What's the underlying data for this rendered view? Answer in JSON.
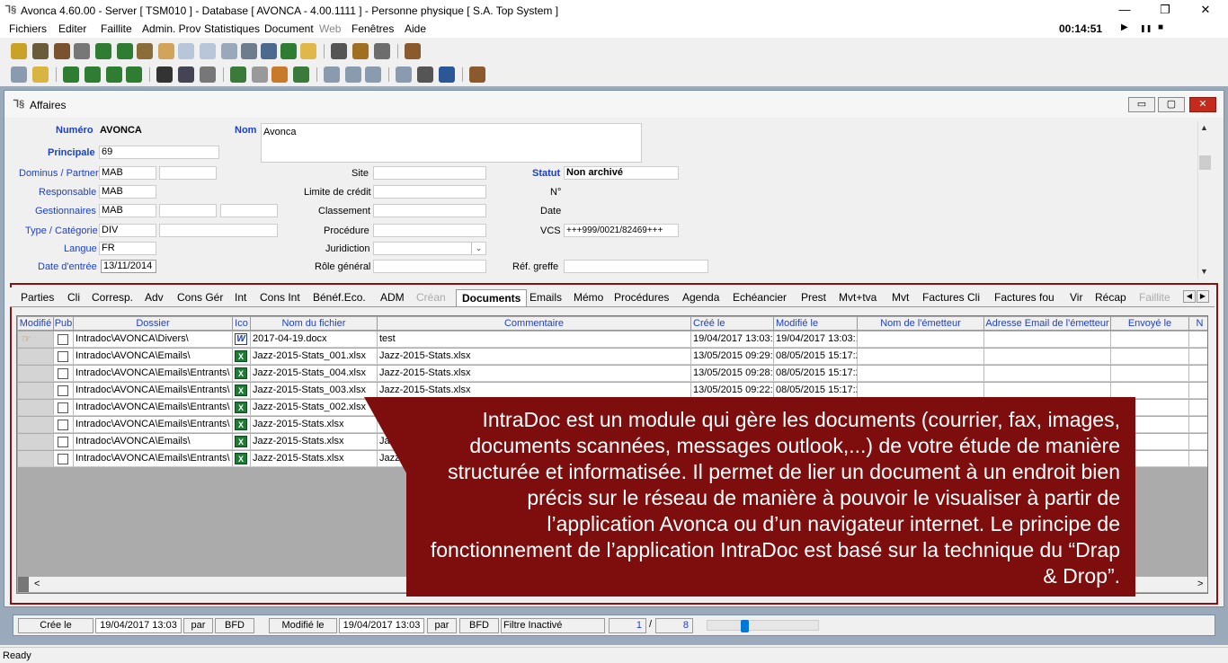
{
  "window": {
    "title": "Avonca 4.60.00 - Server [ TSM010 ] - Database [ AVONCA - 4.00.1111 ] - Personne physique [ S.A. Top System ]",
    "minimize": "—",
    "restore": "❐",
    "close": "✕"
  },
  "menu": {
    "items": [
      "Fichiers",
      "Editer",
      "Faillite",
      "Admin. Prov",
      "Statistiques",
      "Document",
      "Web",
      "Fenêtres",
      "Aide"
    ],
    "timer": "00:14:51",
    "play": "▶",
    "pause": "❚❚",
    "stop": "■"
  },
  "child": {
    "title": "Affaires",
    "min": "▭",
    "max": "▢",
    "close": "✕"
  },
  "form": {
    "numero_label": "Numéro",
    "numero_value": "AVONCA",
    "nom_label": "Nom",
    "nom_value": "Avonca",
    "principale_label": "Principale",
    "principale_value": "69",
    "dominus_label": "Dominus / Partner",
    "dominus_value": "MAB",
    "responsable_label": "Responsable",
    "responsable_value": "MAB",
    "gestionnaires_label": "Gestionnaires",
    "gestionnaires_value": "MAB",
    "type_label": "Type / Catégorie",
    "type_value": "DIV",
    "langue_label": "Langue",
    "langue_value": "FR",
    "date_entree_label": "Date d'entrée",
    "date_entree_value": "13/11/2014",
    "site_label": "Site",
    "limite_label": "Limite de crédit",
    "classement_label": "Classement",
    "procedure_label": "Procédure",
    "juridiction_label": "Juridiction",
    "role_label": "Rôle général",
    "statut_label": "Statut",
    "statut_value": "Non archivé",
    "no_label": "N°",
    "date_label": "Date",
    "vcs_label": "VCS",
    "vcs_value": "+++999/0021/82469+++",
    "ref_greffe_label": "Réf. greffe"
  },
  "tabs": [
    {
      "label": "Parties"
    },
    {
      "label": "Cli"
    },
    {
      "label": "Corresp."
    },
    {
      "label": "Adv"
    },
    {
      "label": "Cons Gér"
    },
    {
      "label": "Int"
    },
    {
      "label": "Cons Int"
    },
    {
      "label": "Bénéf.Eco."
    },
    {
      "label": "ADM"
    },
    {
      "label": "Créan"
    },
    {
      "label": "Documents"
    },
    {
      "label": "Emails"
    },
    {
      "label": "Mémo"
    },
    {
      "label": "Procédures"
    },
    {
      "label": "Agenda"
    },
    {
      "label": "Echéancier"
    },
    {
      "label": "Prest"
    },
    {
      "label": "Mvt+tva"
    },
    {
      "label": "Mvt"
    },
    {
      "label": "Factures Cli"
    },
    {
      "label": "Factures fou"
    },
    {
      "label": "Vir"
    },
    {
      "label": "Récap"
    },
    {
      "label": "Faillite"
    }
  ],
  "grid": {
    "headers": [
      "Modifié",
      "Pub",
      "Dossier",
      "Ico",
      "Nom du fichier",
      "Commentaire",
      "Créé le",
      "Modifié le",
      "Nom de l'émetteur",
      "Adresse Email de l'émetteur",
      "Envoyé le",
      "N"
    ],
    "rows": [
      {
        "dossier": "Intradoc\\AVONCA\\Divers\\",
        "ico": "W",
        "fichier": "2017-04-19.docx",
        "commentaire": "test",
        "cree": "19/04/2017 13:03:1",
        "modifie": "19/04/2017 13:03:1"
      },
      {
        "dossier": "Intradoc\\AVONCA\\Emails\\",
        "ico": "X",
        "fichier": "Jazz-2015-Stats_001.xlsx",
        "commentaire": "Jazz-2015-Stats.xlsx",
        "cree": "13/05/2015 09:29:",
        "modifie": "08/05/2015 15:17:2"
      },
      {
        "dossier": "Intradoc\\AVONCA\\Emails\\Entrants\\",
        "ico": "X",
        "fichier": "Jazz-2015-Stats_004.xlsx",
        "commentaire": "Jazz-2015-Stats.xlsx",
        "cree": "13/05/2015 09:28:3",
        "modifie": "08/05/2015 15:17:2"
      },
      {
        "dossier": "Intradoc\\AVONCA\\Emails\\Entrants\\",
        "ico": "X",
        "fichier": "Jazz-2015-Stats_003.xlsx",
        "commentaire": "Jazz-2015-Stats.xlsx",
        "cree": "13/05/2015 09:22:5",
        "modifie": "08/05/2015 15:17:2"
      },
      {
        "dossier": "Intradoc\\AVONCA\\Emails\\Entrants\\",
        "ico": "X",
        "fichier": "Jazz-2015-Stats_002.xlsx",
        "commentaire": "",
        "cree": "",
        "modifie": ""
      },
      {
        "dossier": "Intradoc\\AVONCA\\Emails\\Entrants\\",
        "ico": "X",
        "fichier": "Jazz-2015-Stats.xlsx",
        "commentaire": "",
        "cree": "",
        "modifie": ""
      },
      {
        "dossier": "Intradoc\\AVONCA\\Emails\\",
        "ico": "X",
        "fichier": "Jazz-2015-Stats.xlsx",
        "commentaire": "Ja",
        "cree": "",
        "modifie": ""
      },
      {
        "dossier": "Intradoc\\AVONCA\\Emails\\Entrants\\",
        "ico": "X",
        "fichier": "Jazz-2015-Stats.xlsx",
        "commentaire": "Jazz",
        "cree": "",
        "modifie": ""
      }
    ]
  },
  "overlay": {
    "text": "IntraDoc est un module qui gère les documents (courrier, fax, images, documents scannées, messages outlook,...) de votre étude de manière structurée et informatisée. Il permet de lier un document à un endroit bien précis sur le réseau de manière à pouvoir le visualiser à partir de l’application Avonca ou d’un navigateur internet. Le principe de fonctionnement de l’application IntraDoc est basé sur la technique du “Drap & Drop”."
  },
  "status": {
    "cree_label": "Crée le",
    "cree_value": "19/04/2017 13:03",
    "par1": "par",
    "user1": "BFD",
    "modifie_label": "Modifié le",
    "modifie_value": "19/04/2017 13:03",
    "par2": "par",
    "user2": "BFD",
    "filtre": "Filtre Inactivé",
    "page_current": "1",
    "slash": "/",
    "page_total": "8",
    "ready": "Ready"
  },
  "colors": {
    "overlay_bg": "#7e0e0e",
    "label_blue": "#1a3fcf",
    "excel_green": "#1e7b34"
  }
}
